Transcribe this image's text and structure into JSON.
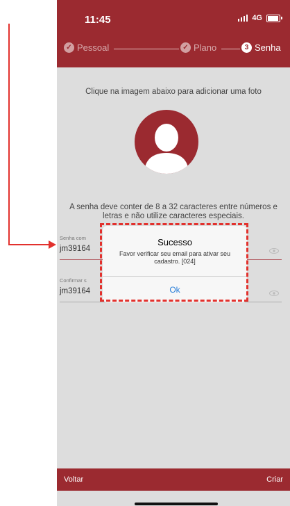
{
  "status": {
    "time": "11:45",
    "network": "4G"
  },
  "steps": [
    {
      "label": "Pessoal",
      "marker": "✓",
      "state": "done"
    },
    {
      "label": "Plano",
      "marker": "✓",
      "state": "done"
    },
    {
      "label": "Senha",
      "marker": "3",
      "state": "active"
    }
  ],
  "instruction": "Clique na imagem abaixo para adicionar uma foto",
  "avatar_icon": "user-silhouette-icon",
  "password_rules": "A senha deve conter de 8 a 32 caracteres entre números e letras e não utilize caracteres especiais.",
  "fields": {
    "password": {
      "label": "Senha com",
      "value": "jm39164",
      "icon": "eye-icon"
    },
    "confirm": {
      "label": "Confirmar s",
      "value": "jm39164",
      "icon": "eye-icon"
    }
  },
  "dialog": {
    "title": "Sucesso",
    "message": "Favor verificar seu email para ativar seu cadastro. [024]",
    "ok_label": "Ok"
  },
  "footer": {
    "back_label": "Voltar",
    "create_label": "Criar"
  },
  "colors": {
    "brand": "#9b2a30",
    "annotation": "#e2312d",
    "link": "#2b7fd8",
    "background": "#dddddd"
  }
}
